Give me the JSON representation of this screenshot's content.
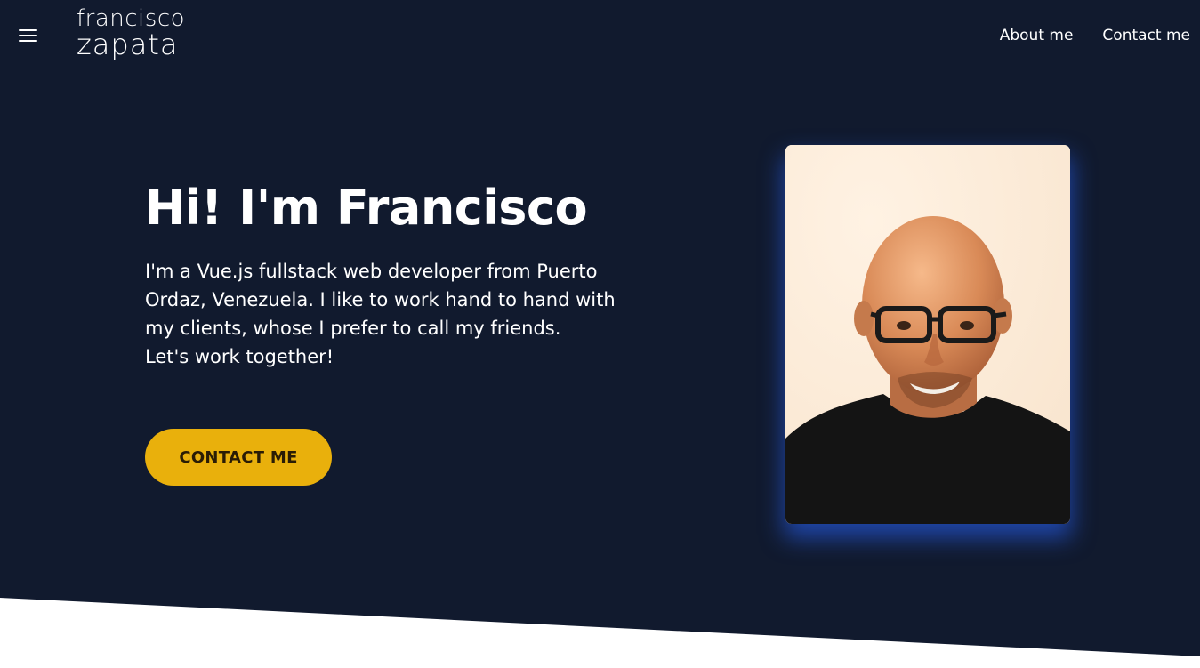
{
  "logo": {
    "line1": "francisco",
    "line2": "zapata"
  },
  "nav": {
    "about": "About me",
    "contact": "Contact me"
  },
  "hero": {
    "title": "Hi! I'm Francisco",
    "description_lines": [
      "I'm a Vue.js fullstack web developer from Puerto",
      "Ordaz, Venezuela. I like to work hand to hand with",
      "my clients, whose I prefer to call my friends.",
      "Let's work together!"
    ],
    "cta_label": "CONTACT ME"
  },
  "colors": {
    "background": "#111a2e",
    "accent": "#e9b00c",
    "photo_glow": "#265ce6",
    "section_bottom": "#ffffff"
  },
  "icons": {
    "menu": "hamburger-icon"
  }
}
